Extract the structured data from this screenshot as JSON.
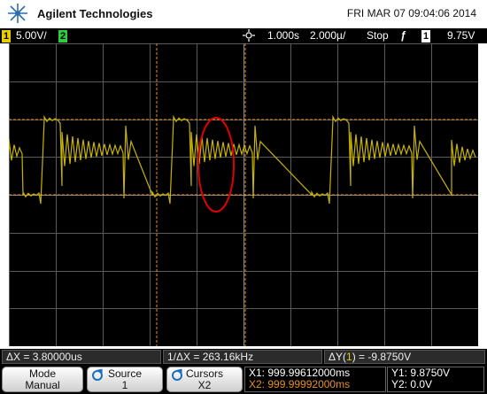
{
  "header": {
    "brand": "Agilent Technologies",
    "datetime": "FRI MAR 07 09:04:06 2014"
  },
  "status_bar": {
    "ch1_num": "1",
    "ch1_scale": "5.00V/",
    "ch2_num": "2",
    "timebase": "1.000s",
    "time_div": "2.000µ/",
    "run_state": "Stop",
    "trig_num": "1",
    "trig_level": "9.75V"
  },
  "measurements": {
    "dx": "ΔX = 3.80000us",
    "inv_dx": "1/ΔX = 263.16kHz",
    "dy_prefix": "ΔY(",
    "dy_ch": "1",
    "dy_suffix": ") = -9.8750V"
  },
  "softkeys": {
    "mode_label": "Mode",
    "mode_value": "Manual",
    "source_label": "Source",
    "source_value": "1",
    "cursors_label": "Cursors",
    "cursors_value": "X2",
    "x1": "X1: 999.99612000ms",
    "x2": "X2: 999.99992000ms",
    "y1": "Y1: 9.8750V",
    "y2": "Y2: 0.0V"
  },
  "colors": {
    "trace": "#c8b400",
    "cursor": "#e89020",
    "ch2": "#2ecc40",
    "highlight": "#e00000"
  },
  "icons": [
    "agilent-logo-icon",
    "trigger-marker-icon",
    "rotary-knob-icon",
    "trigger-edge-icon"
  ]
}
